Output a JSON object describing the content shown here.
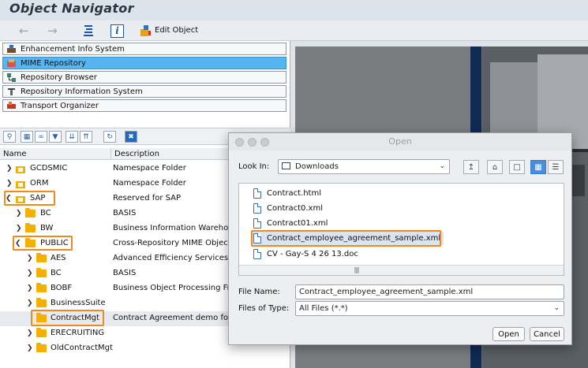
{
  "app": {
    "title": "Object Navigator"
  },
  "toolbar": {
    "back": "←",
    "forward": "→",
    "info": "i",
    "edit_object": "Edit Object"
  },
  "nav_buttons": [
    {
      "label": "Enhancement Info System",
      "icon": "enhancement-icon",
      "selected": false
    },
    {
      "label": "MIME Repository",
      "icon": "mime-icon",
      "selected": true
    },
    {
      "label": "Repository Browser",
      "icon": "repository-browser-icon",
      "selected": false
    },
    {
      "label": "Repository Information System",
      "icon": "repository-info-icon",
      "selected": false
    },
    {
      "label": "Transport Organizer",
      "icon": "transport-icon",
      "selected": false
    }
  ],
  "tree": {
    "col_name": "Name",
    "col_description": "Description",
    "rows": [
      {
        "name": "GCDSMIC",
        "description": "Namespace Folder",
        "level": 0,
        "expanded": false
      },
      {
        "name": "ORM",
        "description": "Namespace Folder",
        "level": 0,
        "expanded": false
      },
      {
        "name": "SAP",
        "description": "Reserved for SAP",
        "level": 0,
        "expanded": true
      },
      {
        "name": "BC",
        "description": "BASIS",
        "level": 1,
        "expanded": false
      },
      {
        "name": "BW",
        "description": "Business Information Warehouse",
        "level": 1,
        "expanded": false
      },
      {
        "name": "PUBLIC",
        "description": "Cross-Repository MIME Objects",
        "level": 1,
        "expanded": true
      },
      {
        "name": "AES",
        "description": "Advanced Efficiency Services",
        "level": 2,
        "expanded": false
      },
      {
        "name": "BC",
        "description": "BASIS",
        "level": 2,
        "expanded": false
      },
      {
        "name": "BOBF",
        "description": "Business Object Processing Framework",
        "level": 2,
        "expanded": false
      },
      {
        "name": "BusinessSuite",
        "description": "",
        "level": 2,
        "expanded": false
      },
      {
        "name": "ContractMgt",
        "description": "Contract Agreement demo for",
        "level": 2,
        "expanded": false,
        "selected": true
      },
      {
        "name": "ERECRUITING",
        "description": "",
        "level": 2,
        "expanded": false
      },
      {
        "name": "OldContractMgt",
        "description": "",
        "level": 2,
        "expanded": false
      }
    ]
  },
  "dialog": {
    "title": "Open",
    "look_in_label": "Look In:",
    "look_in_value": "Downloads",
    "files": [
      "Contract.html",
      "Contract0.xml",
      "Contract01.xml",
      "Contract_employee_agreement_sample.xml",
      "CV - Gay-S  4 26 13.doc"
    ],
    "selected_file": "Contract_employee_agreement_sample.xml",
    "file_name_label": "File Name:",
    "file_name_value": "Contract_employee_agreement_sample.xml",
    "files_of_type_label": "Files of Type:",
    "files_of_type_value": "All Files (*.*)",
    "open_button": "Open",
    "cancel_button": "Cancel"
  },
  "colors": {
    "selection_blue": "#56b6f2",
    "highlight_orange": "#f08a1c",
    "folder_yellow": "#f4b000"
  }
}
